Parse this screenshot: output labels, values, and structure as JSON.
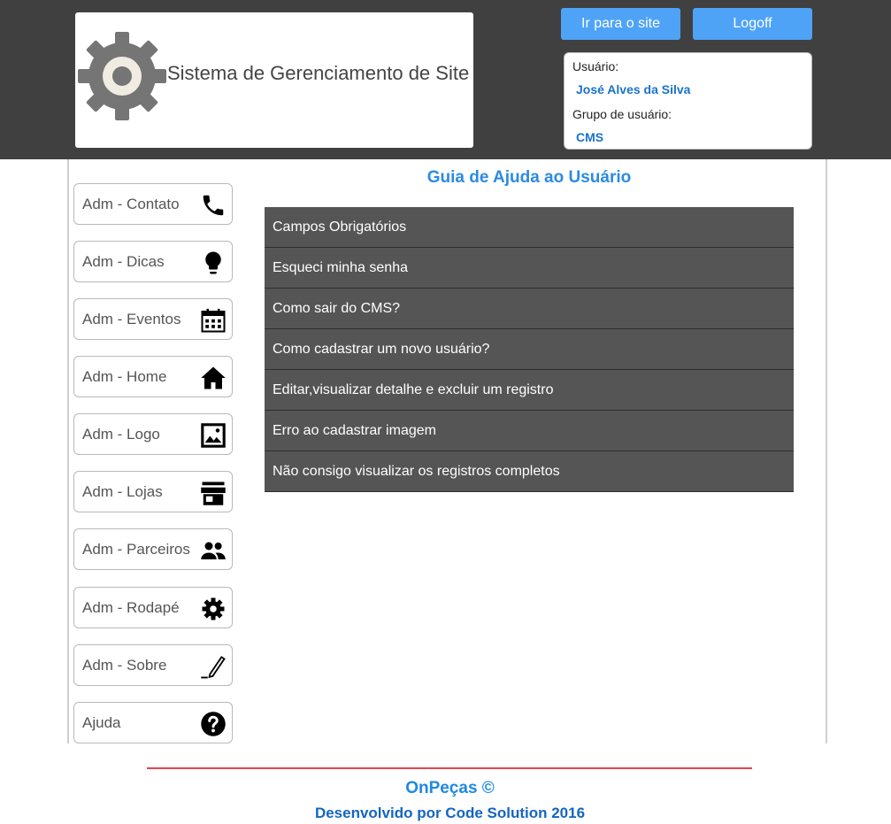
{
  "header": {
    "logo_text": "Sistema de Gerenciamento de Site",
    "site_button": "Ir para o site",
    "logoff_button": "Logoff",
    "user_label": "Usuário:",
    "user_name": "José Alves da Silva",
    "group_label": "Grupo de usuário:",
    "group_name": "CMS"
  },
  "sidebar": {
    "items": [
      {
        "label": "Adm - Contato",
        "icon": "phone-icon"
      },
      {
        "label": "Adm - Dicas",
        "icon": "lightbulb-icon"
      },
      {
        "label": "Adm - Eventos",
        "icon": "calendar-icon"
      },
      {
        "label": "Adm - Home",
        "icon": "home-icon"
      },
      {
        "label": "Adm - Logo",
        "icon": "image-icon"
      },
      {
        "label": "Adm - Lojas",
        "icon": "store-icon"
      },
      {
        "label": "Adm - Parceiros",
        "icon": "people-icon"
      },
      {
        "label": "Adm - Rodapé",
        "icon": "gear-icon"
      },
      {
        "label": "Adm - Sobre",
        "icon": "pencil-icon"
      },
      {
        "label": "Ajuda",
        "icon": "help-icon"
      }
    ]
  },
  "main": {
    "title": "Guia de Ajuda ao Usuário",
    "faq": [
      "Campos Obrigatórios",
      "Esqueci minha senha",
      "Como sair do CMS?",
      "Como cadastrar um novo usuário?",
      "Editar,visualizar detalhe e excluir um registro",
      "Erro ao cadastrar imagem",
      "Não consigo visualizar os registros completos"
    ]
  },
  "footer": {
    "brand": "OnPeças ©",
    "developer": "Desenvolvido por Code Solution 2016"
  }
}
